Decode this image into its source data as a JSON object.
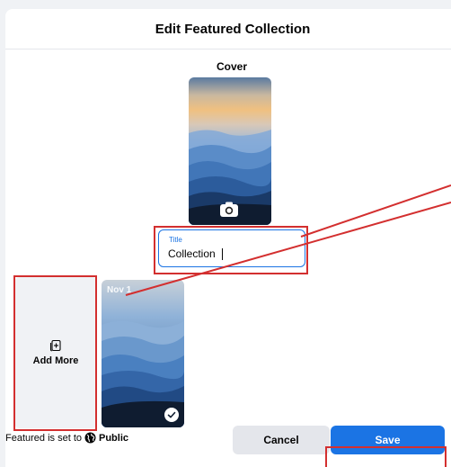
{
  "dialog": {
    "title": "Edit Featured Collection",
    "cover_label": "Cover",
    "title_field": {
      "label": "Title",
      "value": "Collection"
    },
    "add_more_label": "Add More",
    "thumbnail_date": "Nov 1",
    "footer": {
      "featured_prefix": "Featured is set to",
      "privacy": "Public",
      "cancel_label": "Cancel",
      "save_label": "Save"
    }
  },
  "colors": {
    "accent": "#1b74e4",
    "annotation": "#d32f2f"
  },
  "icons": [
    "camera-icon",
    "add-photo-icon",
    "checkmark-icon",
    "globe-icon"
  ]
}
